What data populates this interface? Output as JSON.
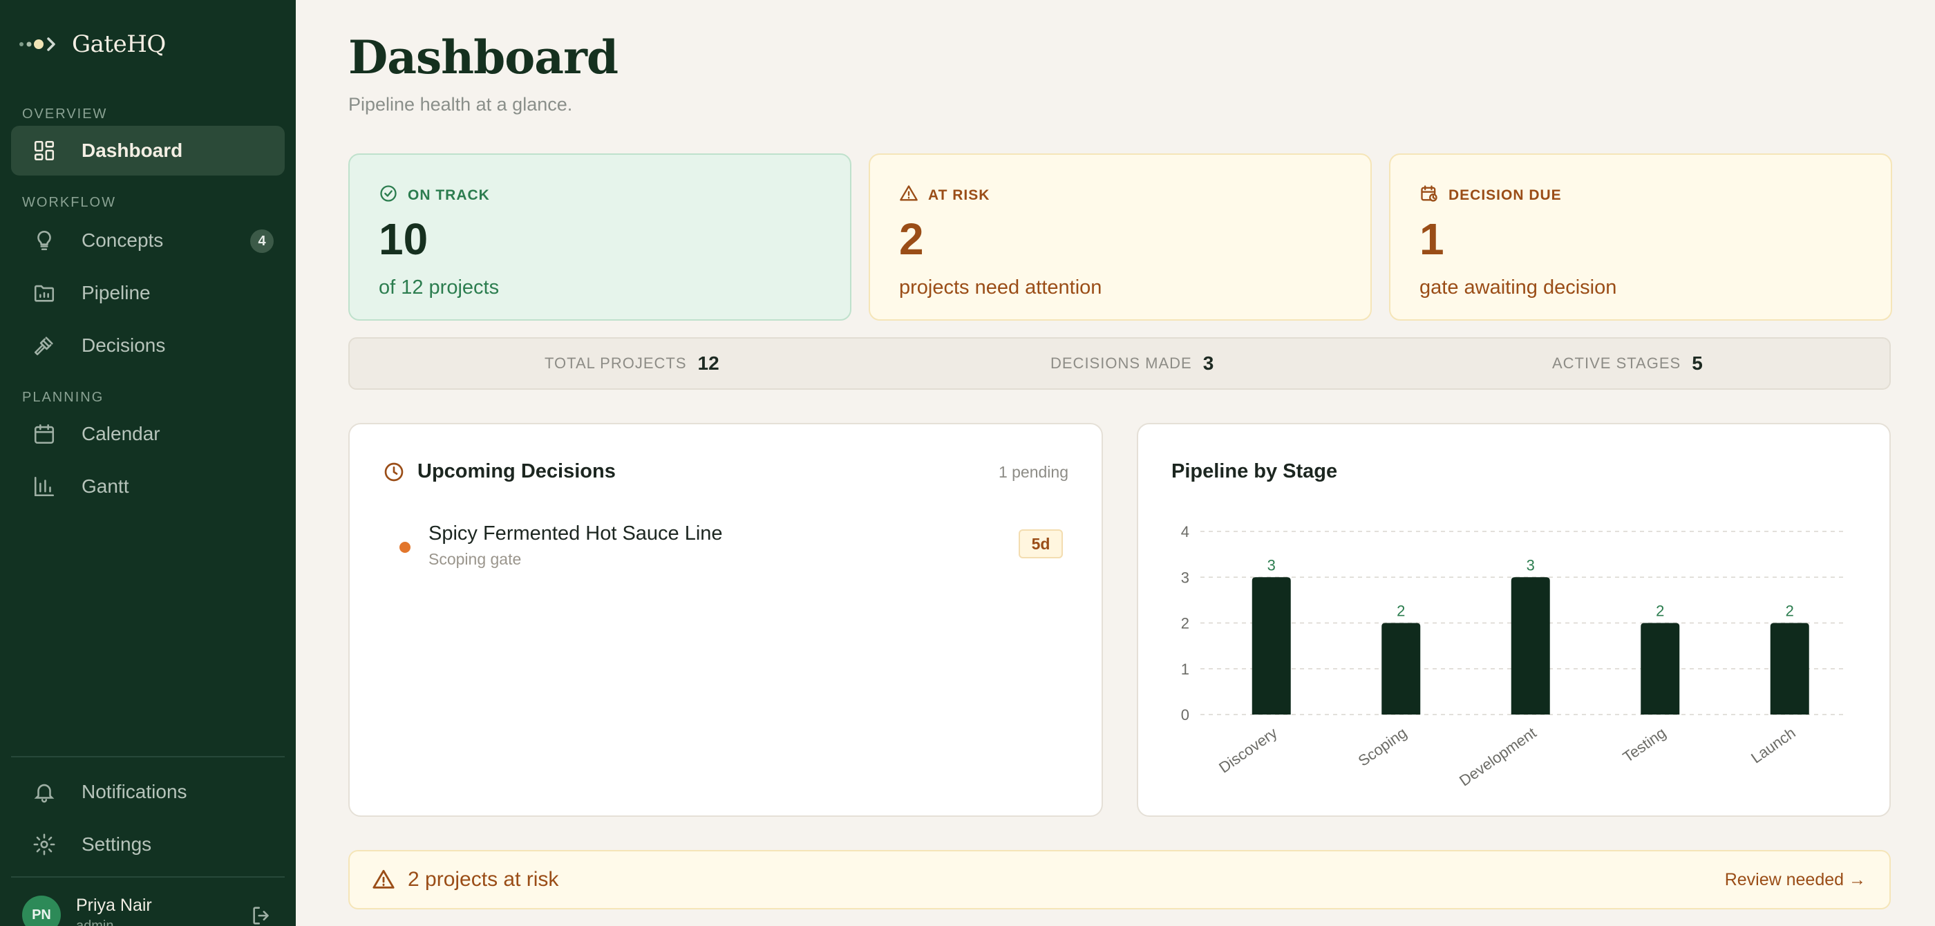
{
  "app": {
    "name": "GateHQ"
  },
  "sidebar": {
    "sections": {
      "overview": "OVERVIEW",
      "workflow": "WORKFLOW",
      "planning": "PLANNING"
    },
    "items": {
      "dashboard": "Dashboard",
      "concepts": "Concepts",
      "concepts_badge": "4",
      "pipeline": "Pipeline",
      "decisions": "Decisions",
      "calendar": "Calendar",
      "gantt": "Gantt",
      "notifications": "Notifications",
      "settings": "Settings"
    },
    "user": {
      "initials": "PN",
      "name": "Priya Nair",
      "role": "admin"
    }
  },
  "header": {
    "title": "Dashboard",
    "subtitle": "Pipeline health at a glance."
  },
  "cards": {
    "on_track": {
      "label": "ON TRACK",
      "value": "10",
      "desc": "of 12 projects"
    },
    "at_risk": {
      "label": "AT RISK",
      "value": "2",
      "desc": "projects need attention"
    },
    "decision_due": {
      "label": "DECISION DUE",
      "value": "1",
      "desc": "gate awaiting decision"
    }
  },
  "stats": {
    "total_projects": {
      "label": "TOTAL PROJECTS",
      "value": "12"
    },
    "decisions_made": {
      "label": "DECISIONS MADE",
      "value": "3"
    },
    "active_stages": {
      "label": "ACTIVE STAGES",
      "value": "5"
    }
  },
  "upcoming": {
    "title": "Upcoming Decisions",
    "pending": "1 pending",
    "items": [
      {
        "title": "Spicy Fermented Hot Sauce Line",
        "sub": "Scoping gate",
        "days": "5d"
      }
    ]
  },
  "pipeline_chart": {
    "title": "Pipeline by Stage"
  },
  "chart_data": {
    "type": "bar",
    "title": "Pipeline by Stage",
    "categories": [
      "Discovery",
      "Scoping",
      "Development",
      "Testing",
      "Launch"
    ],
    "values": [
      3,
      2,
      3,
      2,
      2
    ],
    "ylim": [
      0,
      4
    ],
    "yticks": [
      0,
      1,
      2,
      3,
      4
    ],
    "grid": true,
    "colors": {
      "bar": "#0f2a1c",
      "label": "#2c7d4f"
    }
  },
  "alert": {
    "text": "2 projects at risk",
    "action": "Review needed →"
  }
}
